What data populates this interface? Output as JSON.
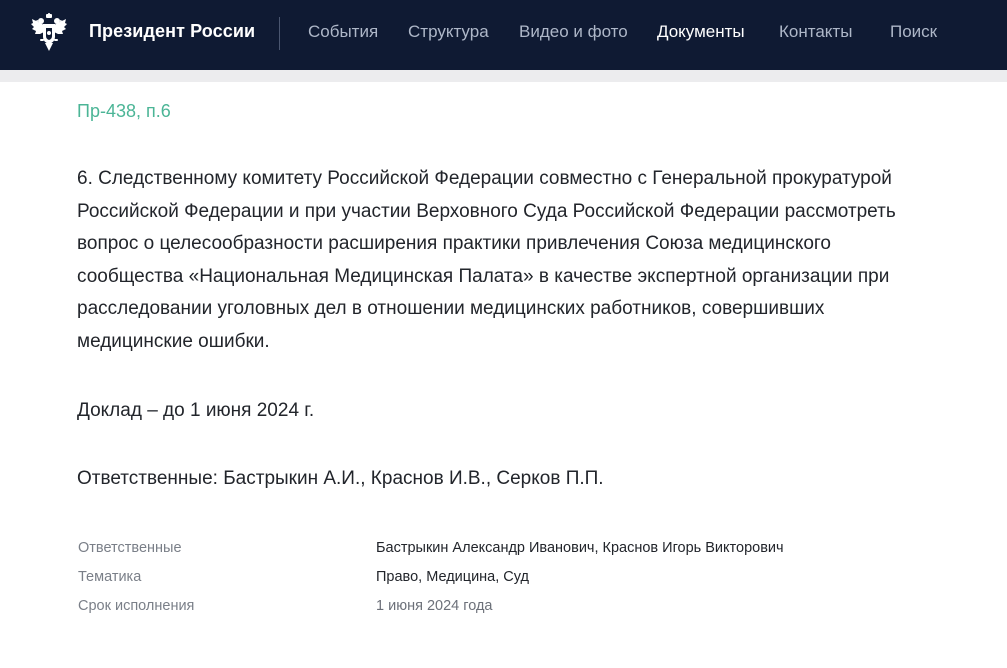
{
  "header": {
    "site_title": "Президент России",
    "nav": [
      {
        "label": "События",
        "active": false
      },
      {
        "label": "Структура",
        "active": false
      },
      {
        "label": "Видео и фото",
        "active": false
      },
      {
        "label": "Документы",
        "active": true
      },
      {
        "label": "Контакты",
        "active": false
      },
      {
        "label": "Поиск",
        "active": false
      }
    ],
    "emblem_icon": "double-headed-eagle-icon"
  },
  "document": {
    "reference": "Пр-438, п.6",
    "paragraphs": [
      "6. Следственному комитету Российской Федерации совместно с Генеральной прокуратурой Российской Федерации и при участии Верховного Суда Российской Федерации рассмотреть вопрос о целесообразности расширения практики привлечения Союза медицинского сообщества «Национальная Медицинская Палата» в качестве экспертной организации при расследовании уголовных дел в отношении медицинских работников, совершивших медицинские ошибки.",
      "Доклад – до 1 июня 2024 г.",
      "Ответственные: Бастрыкин А.И., Краснов И.В., Серков П.П."
    ],
    "meta": [
      {
        "label": "Ответственные",
        "value": "Бастрыкин Александр Иванович, Краснов Игорь Викторович"
      },
      {
        "label": "Тематика",
        "value": "Право, Медицина, Суд"
      },
      {
        "label": "Срок исполнения",
        "value": "1 июня 2024 года"
      }
    ]
  },
  "colors": {
    "header_bg": "#0f1a33",
    "accent_link": "#4bb596",
    "nav_inactive": "#aeb7c8",
    "nav_active": "#ffffff"
  }
}
